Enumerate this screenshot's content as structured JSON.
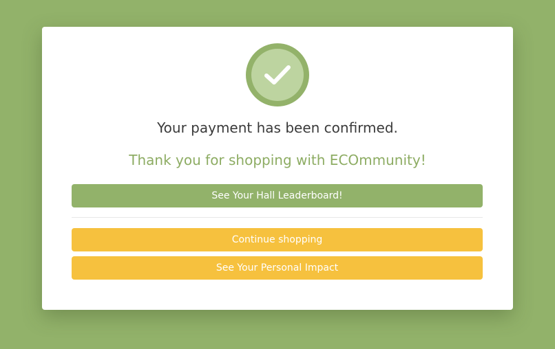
{
  "confirmation": {
    "icon": "checkmark-icon",
    "message": "Your payment has been confirmed.",
    "thanks": "Thank you for shopping with ECOmmunity!"
  },
  "actions": {
    "leaderboard_label": "See Your Hall Leaderboard!",
    "continue_label": "Continue shopping",
    "impact_label": "See Your Personal Impact"
  },
  "colors": {
    "background": "#92b26a",
    "primary_green": "#92b26a",
    "thanks_green": "#8dac63",
    "accent_yellow": "#f6c13e",
    "check_badge_outer": "#93b26a",
    "check_badge_inner": "#bdd4a0"
  }
}
